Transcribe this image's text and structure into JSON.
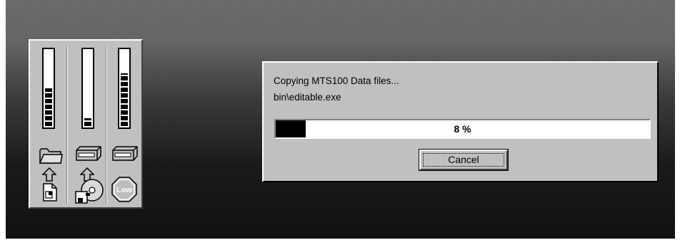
{
  "dialog": {
    "status": "Copying MTS100 Data files...",
    "current_file": "bin\\editable.exe",
    "progress_label": "8 %",
    "progress_fraction": 0.08,
    "cancel_label": "Cancel"
  },
  "meters": {
    "gauges": [
      {
        "id": "source",
        "fill_fraction": 0.5,
        "top_icon": "folder-icon",
        "bottom_icon": "document-icon"
      },
      {
        "id": "destination",
        "fill_fraction": 0.1,
        "top_icon": "hard-drive-icon",
        "bottom_icon": "cd-floppy-icon"
      },
      {
        "id": "free-space",
        "fill_fraction": 0.7,
        "top_icon": "hard-drive-icon",
        "bottom_label": "Low"
      }
    ]
  }
}
